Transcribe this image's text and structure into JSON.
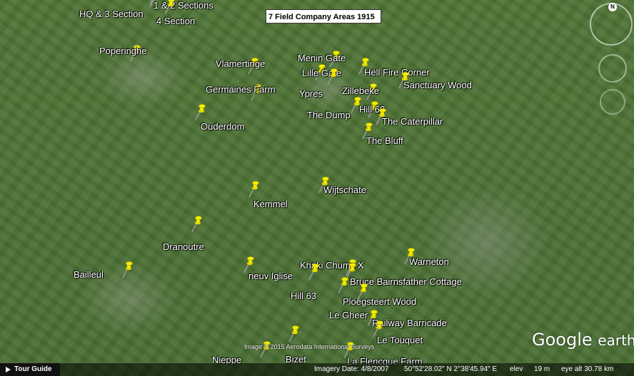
{
  "title": "7 Field Company Areas 1915",
  "places": [
    {
      "id": "hq-3-section",
      "label": "HQ & 3 Section"
    },
    {
      "id": "1-2-sections",
      "label": "1 & 2 Sections"
    },
    {
      "id": "4-section",
      "label": "4 Section"
    },
    {
      "id": "poperinghe",
      "label": "Poperinghe"
    },
    {
      "id": "vlamertinge",
      "label": "Vlamertinge"
    },
    {
      "id": "germaines-farm",
      "label": "Germaines Farm"
    },
    {
      "id": "menin-gate",
      "label": "Menin Gate"
    },
    {
      "id": "lille-gate",
      "label": "Lille Gate"
    },
    {
      "id": "hell-fire-corner",
      "label": "Hell Fire Corner"
    },
    {
      "id": "ypres",
      "label": "Ypres"
    },
    {
      "id": "zillebeke",
      "label": "Zillebeke"
    },
    {
      "id": "sanctuary-wood",
      "label": "Sanctuary Wood"
    },
    {
      "id": "the-dump",
      "label": "The Dump"
    },
    {
      "id": "hill-60",
      "label": "Hill 60"
    },
    {
      "id": "the-caterpillar",
      "label": "The Caterpillar"
    },
    {
      "id": "ouderdom",
      "label": "Ouderdom"
    },
    {
      "id": "the-bluff",
      "label": "The Bluff"
    },
    {
      "id": "wijtschate",
      "label": "Wijtschate"
    },
    {
      "id": "kemmel",
      "label": "Kemmel"
    },
    {
      "id": "dranoutre",
      "label": "Dranoutre"
    },
    {
      "id": "warneton",
      "label": "Warneton"
    },
    {
      "id": "khaki-chums",
      "label": "Khaki Chums X"
    },
    {
      "id": "bailleul",
      "label": "Bailleul"
    },
    {
      "id": "neuv-iglise",
      "label": "neuv Iglise"
    },
    {
      "id": "bruce-bairnsfather",
      "label": "Bruce Bairnsfather Cottage"
    },
    {
      "id": "hill-63",
      "label": "Hill 63"
    },
    {
      "id": "ploegsteert-wood",
      "label": "Ploegsteert Wood"
    },
    {
      "id": "le-gheer",
      "label": "Le Gheer"
    },
    {
      "id": "railway-barricade",
      "label": "Railway Barricade"
    },
    {
      "id": "le-touquet",
      "label": "Le Touquet"
    },
    {
      "id": "nieppe",
      "label": "Nieppe"
    },
    {
      "id": "bizet",
      "label": "Bizet"
    },
    {
      "id": "la-flencque-farm",
      "label": "La Flencque Farm"
    }
  ],
  "ui": {
    "tour_guide": "Tour Guide",
    "copyright": "Image © 2015 Aerodata International Surveys",
    "imagery_date": "Imagery Date: 4/8/2007",
    "coords": "50°52'28.02\" N    2°38'45.94\" E",
    "elev_label": "elev",
    "elev_value": "19 m",
    "eye_alt": "eye alt  30.78 km",
    "brand_main": "Google",
    "brand_sub": "earth",
    "compass_n": "N"
  },
  "colors": {
    "pin": "#f5f000",
    "pin_stroke": "#b8a800",
    "needle": "#9a9a9a"
  }
}
